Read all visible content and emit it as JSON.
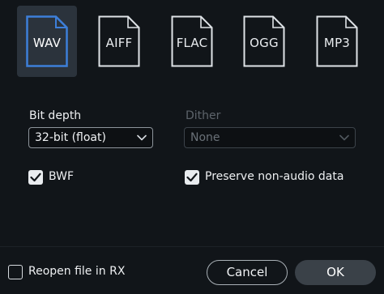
{
  "formats": [
    {
      "label": "WAV",
      "selected": true
    },
    {
      "label": "AIFF",
      "selected": false
    },
    {
      "label": "FLAC",
      "selected": false
    },
    {
      "label": "OGG",
      "selected": false
    },
    {
      "label": "MP3",
      "selected": false
    }
  ],
  "bit_depth": {
    "label": "Bit depth",
    "value": "32-bit (float)",
    "enabled": true
  },
  "dither": {
    "label": "Dither",
    "value": "None",
    "enabled": false
  },
  "options": {
    "bwf": {
      "label": "BWF",
      "checked": true
    },
    "preserve": {
      "label": "Preserve non-audio data",
      "checked": true
    },
    "reopen": {
      "label": "Reopen file in RX",
      "checked": false
    }
  },
  "buttons": {
    "cancel": "Cancel",
    "ok": "OK"
  },
  "colors": {
    "background": "#111519",
    "selected_tile": "#2b333c",
    "accent": "#3d7fd9",
    "ok_button": "#3a4148"
  },
  "icons": {
    "format_tile": "document-icon",
    "select_arrow": "chevron-down-icon",
    "checkbox_mark": "checkmark-icon"
  }
}
